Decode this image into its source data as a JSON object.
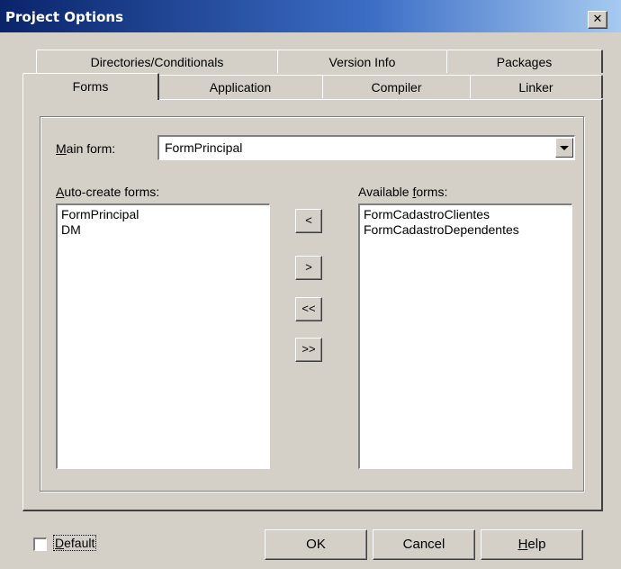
{
  "window": {
    "title": "Project Options",
    "close_label": "✕"
  },
  "tabs_row_back": [
    {
      "label": "Directories/Conditionals"
    },
    {
      "label": "Version Info"
    },
    {
      "label": "Packages"
    }
  ],
  "tabs_row_front": [
    {
      "label": "Forms",
      "selected": true
    },
    {
      "label": "Application"
    },
    {
      "label": "Compiler"
    },
    {
      "label": "Linker"
    }
  ],
  "forms_tab": {
    "main_form_label_hot": "M",
    "main_form_label_rest": "ain form:",
    "main_form_value": "FormPrincipal",
    "auto_create_label_hot": "A",
    "auto_create_label_rest": "uto-create forms:",
    "auto_create_items": [
      "FormPrincipal",
      "DM"
    ],
    "available_label_pre": "Available ",
    "available_label_hot": "f",
    "available_label_rest": "orms:",
    "available_items": [
      "FormCadastroClientes",
      "FormCadastroDependentes"
    ],
    "move_buttons": [
      "<",
      ">",
      "<<",
      ">>"
    ]
  },
  "footer": {
    "default_label_hot": "D",
    "default_label_rest": "efault",
    "default_checked": false,
    "ok_label": "OK",
    "cancel_label": "Cancel",
    "help_label_hot": "H",
    "help_label_rest": "elp"
  }
}
